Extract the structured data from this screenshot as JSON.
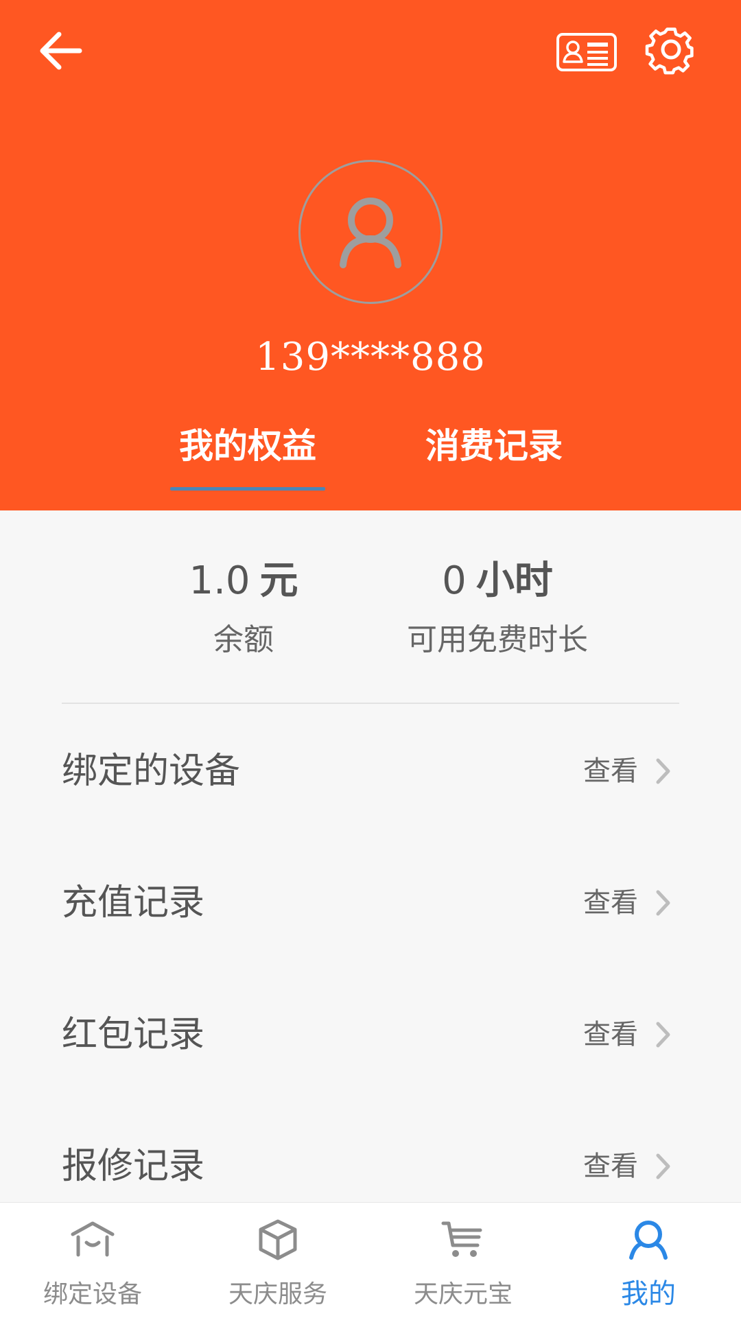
{
  "header": {
    "phone_masked": "139****888",
    "tabs": [
      {
        "label": "我的权益",
        "active": true
      },
      {
        "label": "消费记录",
        "active": false
      }
    ]
  },
  "stats": {
    "balance": {
      "value": "1.0",
      "unit": "元",
      "label": "余额"
    },
    "free_time": {
      "value": "0",
      "unit": "小时",
      "label": "可用免费时长"
    }
  },
  "list": {
    "items": [
      {
        "title": "绑定的设备",
        "action": "查看"
      },
      {
        "title": "充值记录",
        "action": "查看"
      },
      {
        "title": "红包记录",
        "action": "查看"
      },
      {
        "title": "报修记录",
        "action": "查看"
      }
    ]
  },
  "bottom_nav": {
    "items": [
      {
        "label": "绑定设备",
        "icon": "home-hat-icon",
        "active": false
      },
      {
        "label": "天庆服务",
        "icon": "box-icon",
        "active": false
      },
      {
        "label": "天庆元宝",
        "icon": "cart-icon",
        "active": false
      },
      {
        "label": "我的",
        "icon": "user-icon",
        "active": true
      }
    ]
  },
  "colors": {
    "header_bg": "#ff5722",
    "active_nav": "#2b88e6",
    "tab_indicator": "#4a86b8"
  }
}
